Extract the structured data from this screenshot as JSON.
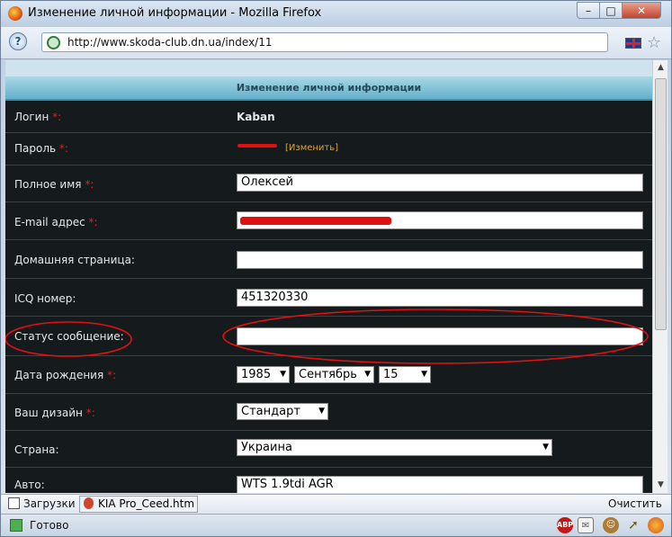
{
  "window": {
    "title": "Изменение личной информации - Mozilla Firefox",
    "controls": {
      "minimize": "–",
      "maximize": "□",
      "close": "✕"
    }
  },
  "navbar": {
    "url": "http://www.skoda-club.dn.ua/index/11",
    "help_label": "?"
  },
  "form": {
    "header": "Изменение личной информации",
    "login": {
      "label": "Логин",
      "required": "*:",
      "value": "Kaban"
    },
    "password": {
      "label": "Пароль",
      "required": "*:",
      "change_link": "[Изменить]"
    },
    "fullname": {
      "label": "Полное имя",
      "required": "*:",
      "value": "Олексей"
    },
    "email": {
      "label": "E-mail адрес",
      "required": "*:"
    },
    "homepage": {
      "label": "Домашняя страница:",
      "value": ""
    },
    "icq": {
      "label": "ICQ номер:",
      "value": "451320330"
    },
    "status": {
      "label": "Статус сообщение:",
      "value": ""
    },
    "birthdate": {
      "label": "Дата рождения",
      "required": "*:",
      "year": "1985",
      "month": "Сентябрь",
      "day": "15"
    },
    "design": {
      "label": "Ваш дизайн",
      "required": "*:",
      "value": "Стандарт"
    },
    "country": {
      "label": "Страна:",
      "value": "Украина"
    },
    "car": {
      "label": "Авто:",
      "value": "WTS 1.9tdi AGR"
    }
  },
  "download_bar": {
    "downloads_label": "Загрузки",
    "item_label": "KIA Pro_Ceed.htm",
    "clear_label": "Очистить"
  },
  "status_bar": {
    "text": "Готово",
    "abp_label": "ABP"
  },
  "colors": {
    "form_background": "#151a1d",
    "header_gradient": "#64b1c9",
    "annotation_red": "#e01010"
  }
}
